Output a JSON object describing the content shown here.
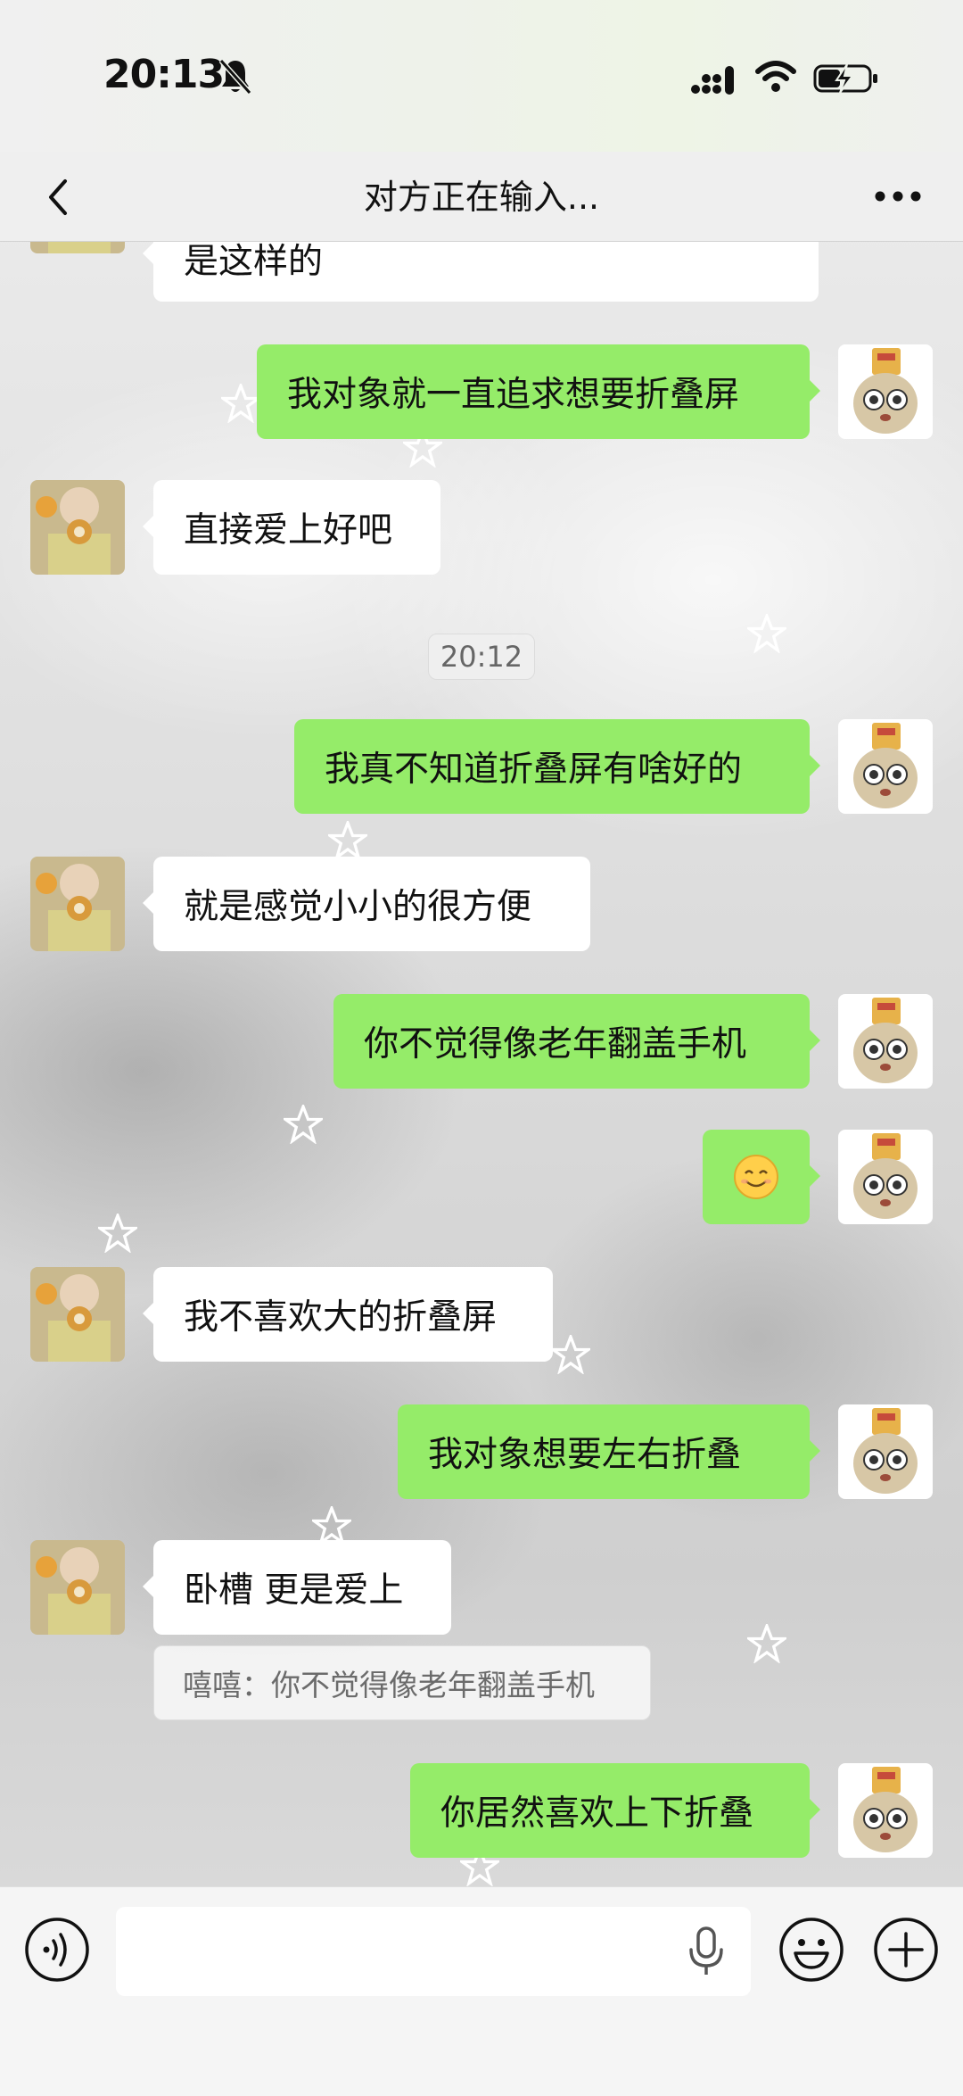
{
  "status_bar": {
    "time": "20:13"
  },
  "nav": {
    "title": "对方正在输入..."
  },
  "messages": [
    {
      "side": "in",
      "text": "是这样的"
    },
    {
      "side": "out",
      "text": "我对象就一直追求想要折叠屏"
    },
    {
      "side": "in",
      "text": "直接爱上好吧"
    },
    {
      "side": "out",
      "text": "我真不知道折叠屏有啥好的"
    },
    {
      "side": "in",
      "text": "就是感觉小小的很方便"
    },
    {
      "side": "out",
      "text": "你不觉得像老年翻盖手机"
    },
    {
      "side": "out",
      "emoji": "smile-emoji"
    },
    {
      "side": "in",
      "text": "我不喜欢大的折叠屏"
    },
    {
      "side": "out",
      "text": "我对象想要左右折叠"
    },
    {
      "side": "in",
      "text": "卧槽 更是爱上"
    },
    {
      "side": "out",
      "text": "你居然喜欢上下折叠"
    }
  ],
  "timestamp": "20:12",
  "quote": "嘻嘻：你不觉得像老年翻盖手机",
  "input_bar": {
    "text_value": ""
  },
  "colors": {
    "outgoing_bubble": "#95ec69",
    "incoming_bubble": "#ffffff",
    "nav_background": "#efefef"
  },
  "icons": [
    "bell-mute-icon",
    "signal-icon",
    "wifi-icon",
    "battery-charging-icon",
    "back-chevron-icon",
    "more-icon",
    "voice-icon",
    "mic-icon",
    "emoji-icon",
    "plus-icon"
  ]
}
